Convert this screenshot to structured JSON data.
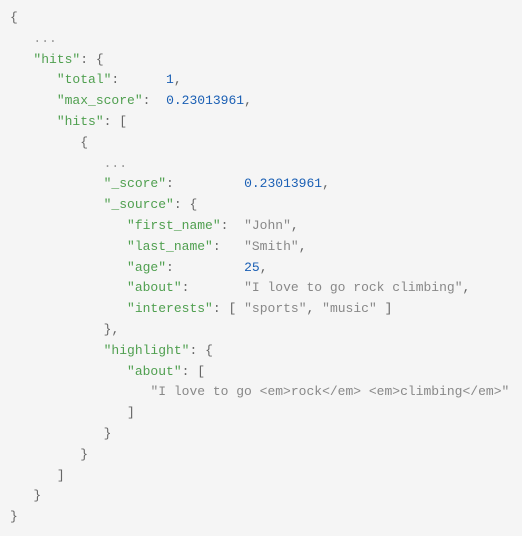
{
  "code": {
    "keys": {
      "hits": "\"hits\"",
      "total": "\"total\"",
      "max_score": "\"max_score\"",
      "score": "\"_score\"",
      "source": "\"_source\"",
      "first_name": "\"first_name\"",
      "last_name": "\"last_name\"",
      "age": "\"age\"",
      "about": "\"about\"",
      "interests": "\"interests\"",
      "highlight": "\"highlight\""
    },
    "values": {
      "total": "1",
      "max_score": "0.23013961",
      "score": "0.23013961",
      "first_name": "\"John\"",
      "last_name": "\"Smith\"",
      "age": "25",
      "about": "\"I love to go rock climbing\"",
      "interests_0": "\"sports\"",
      "interests_1": "\"music\"",
      "highlight_about_0": "\"I love to go <em>rock</em> <em>climbing</em>\""
    },
    "punct": {
      "brace_open": "{",
      "brace_close": "}",
      "bracket_open": "[",
      "bracket_close": "]",
      "colon": ":",
      "comma": ",",
      "ellipsis": "..."
    }
  }
}
